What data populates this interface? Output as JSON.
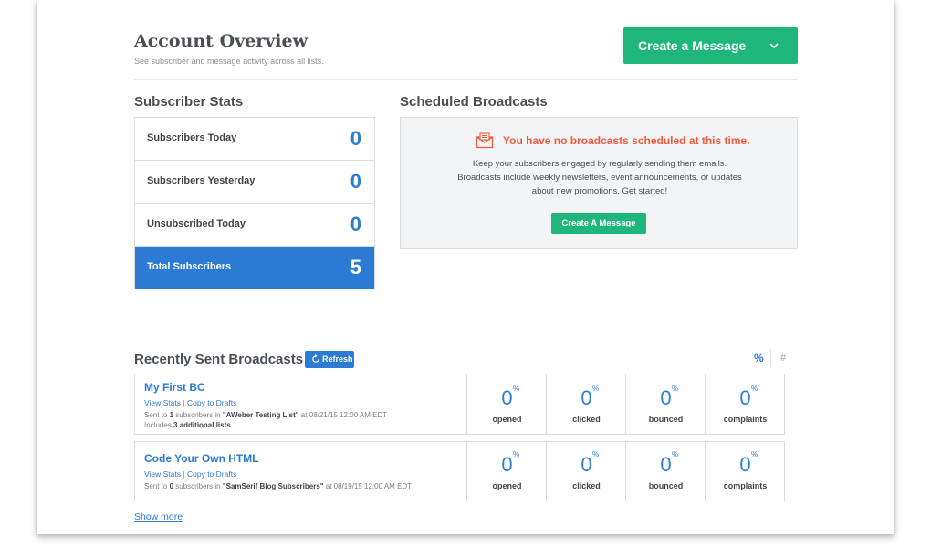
{
  "header": {
    "title": "Account Overview",
    "subtitle": "See subscriber and message activity across all lists.",
    "create_button": "Create a Message"
  },
  "subscriber_stats": {
    "title": "Subscriber Stats",
    "rows": [
      {
        "label": "Subscribers Today",
        "value": "0"
      },
      {
        "label": "Subscribers Yesterday",
        "value": "0"
      },
      {
        "label": "Unsubscribed Today",
        "value": "0"
      },
      {
        "label": "Total Subscribers",
        "value": "5"
      }
    ]
  },
  "scheduled": {
    "title": "Scheduled Broadcasts",
    "warning": "You have no broadcasts scheduled at this time.",
    "body": "Keep your subscribers engaged by regularly sending them emails. Broadcasts include weekly newsletters, event announcements, or updates about new promotions. Get started!",
    "button": "Create A Message"
  },
  "recent": {
    "title": "Recently Sent Broadcasts",
    "refresh": "Refresh",
    "toggle_percent": "%",
    "toggle_count": "#",
    "links": {
      "view_stats": "View Stats",
      "separator": "|",
      "copy": "Copy to Drafts"
    },
    "broadcasts": [
      {
        "name": "My First BC",
        "sent_prefix": "Sent to ",
        "sent_count": "1",
        "sent_mid": " subscribers in ",
        "list": "\"AWeber Testing List\"",
        "sent_suffix": " at 08/21/15 12:00 AM EDT",
        "includes_prefix": "Includes ",
        "includes_count": "3 additional lists",
        "metrics": [
          {
            "value": "0",
            "unit": "%",
            "label": "opened"
          },
          {
            "value": "0",
            "unit": "%",
            "label": "clicked"
          },
          {
            "value": "0",
            "unit": "%",
            "label": "bounced"
          },
          {
            "value": "0",
            "unit": "%",
            "label": "complaints"
          }
        ]
      },
      {
        "name": "Code Your Own HTML",
        "sent_prefix": "Sent to ",
        "sent_count": "0",
        "sent_mid": " subscribers in ",
        "list": "\"SamSerif Blog Subscribers\"",
        "sent_suffix": " at 08/19/15 12:00 AM EDT",
        "metrics": [
          {
            "value": "0",
            "unit": "%",
            "label": "opened"
          },
          {
            "value": "0",
            "unit": "%",
            "label": "clicked"
          },
          {
            "value": "0",
            "unit": "%",
            "label": "bounced"
          },
          {
            "value": "0",
            "unit": "%",
            "label": "complaints"
          }
        ]
      }
    ],
    "show_more": "Show more"
  },
  "colors": {
    "accent_blue": "#2b7ad3",
    "accent_green": "#1eb67a",
    "warning": "#f05a3a"
  }
}
